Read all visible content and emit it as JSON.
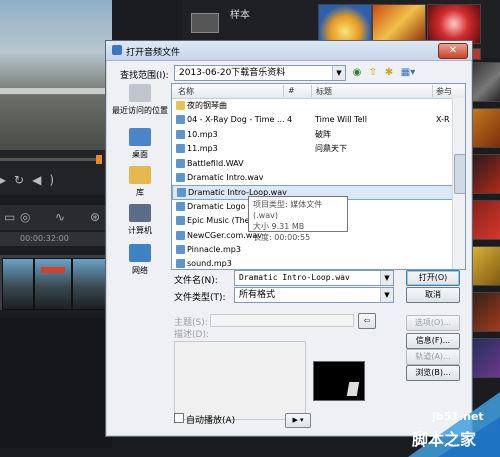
{
  "background": {
    "library_label": "样本",
    "timecode": "00:00:32:00"
  },
  "dialog": {
    "title": "打开音频文件",
    "close_glyph": "✕",
    "look_in_label": "查找范围(I):",
    "look_in_value": "2013-06-20下载音乐资料",
    "places": [
      {
        "label": "最近访问的位置",
        "icon": "recent-places-icon",
        "color": "#c0c6cf"
      },
      {
        "label": "桌面",
        "icon": "desktop-icon",
        "color": "#4b84c9"
      },
      {
        "label": "库",
        "icon": "libraries-icon",
        "color": "#e6b651"
      },
      {
        "label": "计算机",
        "icon": "computer-icon",
        "color": "#5a6c86"
      },
      {
        "label": "网络",
        "icon": "network-icon",
        "color": "#3f82c4"
      }
    ],
    "columns": [
      "名称",
      "#",
      "标题",
      "参与"
    ],
    "files": [
      {
        "name": "夜的钢琴曲",
        "type": "folder",
        "num": "",
        "title": "",
        "artist": ""
      },
      {
        "name": "04 - X-Ray Dog - Time ...",
        "type": "audio",
        "num": "4",
        "title": "Time Will Tell",
        "artist": "X-R"
      },
      {
        "name": "10.mp3",
        "type": "audio",
        "num": "",
        "title": "破阵",
        "artist": ""
      },
      {
        "name": "11.mp3",
        "type": "audio",
        "num": "",
        "title": "问鼎天下",
        "artist": ""
      },
      {
        "name": "Battlefild.WAV",
        "type": "audio",
        "num": "",
        "title": "",
        "artist": ""
      },
      {
        "name": "Dramatic Intro.wav",
        "type": "audio",
        "num": "",
        "title": "",
        "artist": ""
      },
      {
        "name": "Dramatic Intro-Loop.wav",
        "type": "audio",
        "num": "",
        "title": "",
        "artist": "",
        "selected": true
      },
      {
        "name": "Dramatic Logo Intro 5...",
        "type": "audio",
        "num": "",
        "title": "",
        "artist": ""
      },
      {
        "name": "Epic Music (The...",
        "type": "audio",
        "num": "",
        "title": "",
        "artist": ""
      },
      {
        "name": "NewCGer.com.wav",
        "type": "audio",
        "num": "",
        "title": "",
        "artist": ""
      },
      {
        "name": "Pinnacle.mp3",
        "type": "audio",
        "num": "",
        "title": "",
        "artist": ""
      },
      {
        "name": "sound.mp3",
        "type": "audio",
        "num": "",
        "title": "",
        "artist": ""
      }
    ],
    "tooltip": {
      "type": "项目类型: 媒体文件 (.wav)",
      "size": "大小 9.31 MB",
      "length": "长度: 00:00:55"
    },
    "filename_label": "文件名(N):",
    "filename_value": "Dramatic Intro-Loop.wav",
    "filetype_label": "文件类型(T):",
    "filetype_value": "所有格式",
    "open_button": "打开(O)",
    "cancel_button": "取消",
    "subject_label": "主题(S):",
    "description_label": "描述(D):",
    "options_button": "选项(O)...",
    "info_button": "信息(F)...",
    "scan_button": "轨道(A)...",
    "browse_button": "浏览(B)...",
    "autoplay_label": "自动播放(A)",
    "play_glyph": "▶ ▾"
  },
  "watermark": {
    "site": "jb51.net",
    "name": "脚本之家"
  }
}
